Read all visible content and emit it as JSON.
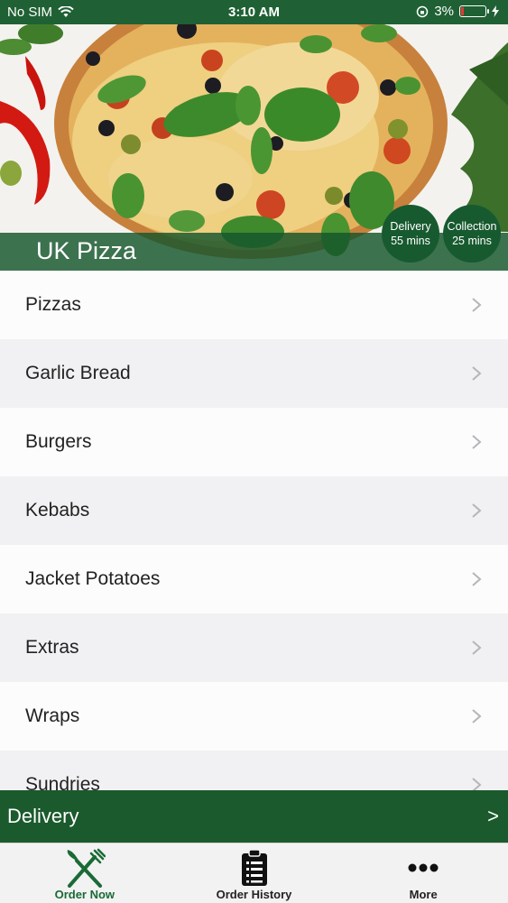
{
  "status_bar": {
    "carrier": "No SIM",
    "time": "3:10 AM",
    "battery": "3%"
  },
  "restaurant": {
    "name": "UK Pizza",
    "delivery": {
      "label": "Delivery",
      "time": "55 mins"
    },
    "collection": {
      "label": "Collection",
      "time": "25 mins"
    }
  },
  "menu": {
    "categories": [
      {
        "label": "Pizzas"
      },
      {
        "label": "Garlic Bread"
      },
      {
        "label": "Burgers"
      },
      {
        "label": "Kebabs"
      },
      {
        "label": "Jacket Potatoes"
      },
      {
        "label": "Extras"
      },
      {
        "label": "Wraps"
      },
      {
        "label": "Sundries"
      }
    ]
  },
  "order_mode": {
    "label": "Delivery",
    "arrow": ">"
  },
  "tabs": [
    {
      "label": "Order Now",
      "icon": "fork-knife-icon"
    },
    {
      "label": "Order History",
      "icon": "clipboard-list-icon"
    },
    {
      "label": "More",
      "icon": "more-dots-icon"
    }
  ],
  "colors": {
    "brand": "#1a5a2c",
    "active_tab": "#1a6a35"
  }
}
